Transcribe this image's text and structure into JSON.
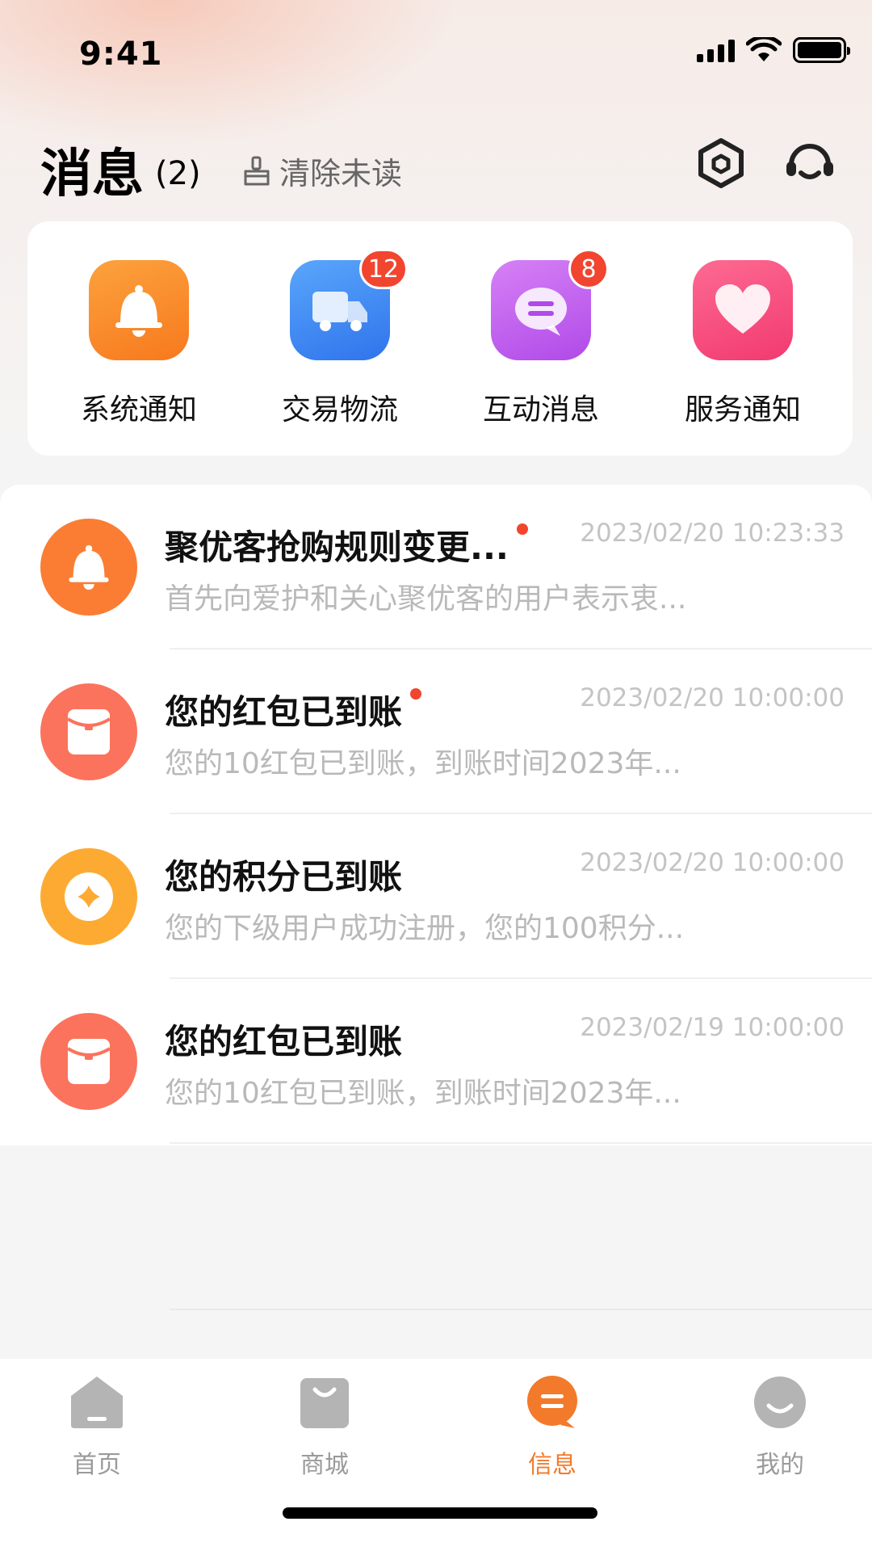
{
  "status_bar": {
    "time": "9:41"
  },
  "header": {
    "title": "消息",
    "count": "(2)",
    "clear_unread": "清除未读",
    "icons": [
      "settings-hex-icon",
      "customer-service-headset-icon"
    ]
  },
  "categories": [
    {
      "label": "系统通知",
      "icon": "bell-icon",
      "color": "#f98b2b",
      "badge": ""
    },
    {
      "label": "交易物流",
      "icon": "truck-icon",
      "color": "#3b86f2",
      "badge": "12"
    },
    {
      "label": "互动消息",
      "icon": "chat-bubble-icon",
      "color": "#c65ef0",
      "badge": "8"
    },
    {
      "label": "服务通知",
      "icon": "heart-icon",
      "color": "#f7457e",
      "badge": ""
    }
  ],
  "messages": [
    {
      "title": "聚优客抢购规则变更...",
      "time": "2023/02/20 10:23:33",
      "preview": "首先向爱护和关心聚优客的用户表示衷...",
      "unread": true,
      "icon": "bell-icon",
      "color": "#fa7d33"
    },
    {
      "title": "您的红包已到账",
      "time": "2023/02/20 10:00:00",
      "preview": "您的10红包已到账，到账时间2023年...",
      "unread": true,
      "icon": "red-envelope-icon",
      "color": "#fb735c"
    },
    {
      "title": "您的积分已到账",
      "time": "2023/02/20 10:00:00",
      "preview": "您的下级用户成功注册，您的100积分...",
      "unread": false,
      "icon": "points-coin-icon",
      "color": "#fdaa33"
    },
    {
      "title": "您的红包已到账",
      "time": "2023/02/19 10:00:00",
      "preview": "您的10红包已到账，到账时间2023年...",
      "unread": false,
      "icon": "red-envelope-icon",
      "color": "#fb735c"
    }
  ],
  "tabs": [
    {
      "label": "首页",
      "icon": "home-icon",
      "active": false
    },
    {
      "label": "商城",
      "icon": "shopping-bag-icon",
      "active": false
    },
    {
      "label": "信息",
      "icon": "message-icon",
      "active": true
    },
    {
      "label": "我的",
      "icon": "profile-icon",
      "active": false
    }
  ],
  "colors": {
    "accent": "#f37a2a",
    "badge": "#f1452f",
    "inactive_tab": "#9a9a9a"
  }
}
